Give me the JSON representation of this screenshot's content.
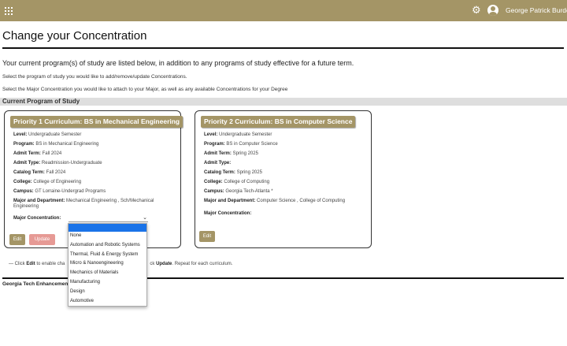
{
  "header": {
    "username": "George Patrick Burdell",
    "icons": [
      "grid-icon",
      "gear-icon",
      "user-avatar-icon"
    ]
  },
  "page": {
    "title": "Change your Concentration",
    "intro": "Your current program(s) of study are listed below, in addition to any programs of study effective for a future term.",
    "note1": "Select the program of study you would like to add/remove/update Concentrations.",
    "note2": "Select the Major Concentration you would like to attach to your Major, as well as any available Concentrations for your Degree",
    "section_title": "Current Program of Study"
  },
  "cards": [
    {
      "header": "Priority 1 Curriculum: BS in Mechanical Engineering",
      "fields": [
        {
          "label": "Level:",
          "value": "Undergraduate Semester"
        },
        {
          "label": "Program:",
          "value": "BS in Mechanical Engineering"
        },
        {
          "label": "Admit Term:",
          "value": "Fall 2024"
        },
        {
          "label": "Admit Type:",
          "value": "Readmission-Undergraduate"
        },
        {
          "label": "Catalog Term:",
          "value": "Fall 2024"
        },
        {
          "label": "College:",
          "value": "College of Engineering"
        },
        {
          "label": "Campus:",
          "value": "GT Lorraine-Undergrad Programs"
        },
        {
          "label": "Major and Department:",
          "value": "Mechanical Engineering , Sch/Mechanical Engineering"
        },
        {
          "label": "Major Concentration:",
          "value": ""
        }
      ],
      "edit_label": "Edit",
      "update_label": "Update"
    },
    {
      "header": "Priority 2 Curriculum: BS in Computer Science",
      "fields": [
        {
          "label": "Level:",
          "value": "Undergraduate Semester"
        },
        {
          "label": "Program:",
          "value": "BS in Computer Science"
        },
        {
          "label": "Admit Term:",
          "value": "Spring 2025"
        },
        {
          "label": "Admit Type:",
          "value": ""
        },
        {
          "label": "Catalog Term:",
          "value": "Spring 2025"
        },
        {
          "label": "College:",
          "value": "College of Computing"
        },
        {
          "label": "Campus:",
          "value": "Georgia Tech-Atlanta *"
        },
        {
          "label": "Major and Department:",
          "value": "Computer Science , College of Computing"
        },
        {
          "label": "Major Concentration:",
          "value": ""
        }
      ],
      "edit_label": "Edit"
    }
  ],
  "footnote": {
    "prefix": "— Click",
    "edit": "Edit",
    "middle": "to enable cha",
    "middle2": "ck",
    "update": "Update",
    "suffix": ". Repeat for each curriculum."
  },
  "enhancement": "Georgia Tech Enhancement",
  "dropdown": {
    "options": [
      "None",
      "Automation and Robotic Systems",
      "Thermal, Fluid & Energy System",
      "Micro & Nanoengineering",
      "Mechanics of Materials",
      "Manufacturing",
      "Design",
      "Automotive"
    ]
  },
  "colors": {
    "accent": "#a49566",
    "update_button": "#e69a95",
    "highlight": "#1a73e8"
  }
}
